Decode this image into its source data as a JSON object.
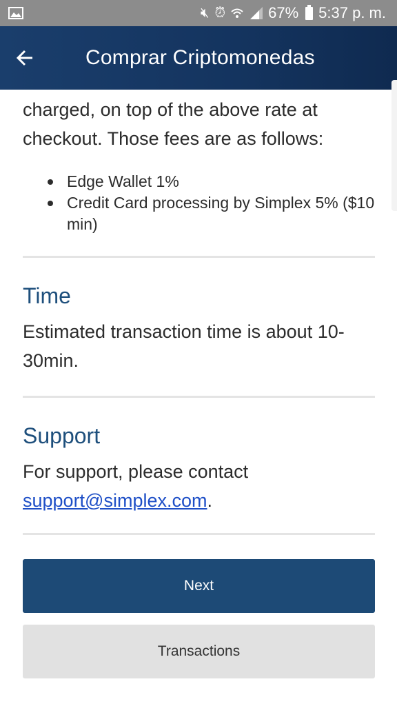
{
  "status_bar": {
    "battery_percent": "67%",
    "time": "5:37 p. m."
  },
  "header": {
    "title": "Comprar Criptomonedas"
  },
  "fees": {
    "intro": "charged, on top of the above rate at checkout. Those fees are as follows:",
    "items": [
      "Edge Wallet 1%",
      "Credit Card processing by Simplex 5% ($10 min)"
    ]
  },
  "time_section": {
    "title": "Time",
    "body": "Estimated transaction time is about 10-30min."
  },
  "support_section": {
    "title": "Support",
    "body_prefix": "For support, please contact",
    "email": "support@simplex.com",
    "body_suffix": "."
  },
  "buttons": {
    "next": "Next",
    "transactions": "Transactions"
  },
  "colors": {
    "header": "#1a3e6c",
    "primary_button": "#1d4a76",
    "secondary_button": "#e1e1e1",
    "section_title": "#1e4f7c",
    "link": "#1e4fc7"
  }
}
